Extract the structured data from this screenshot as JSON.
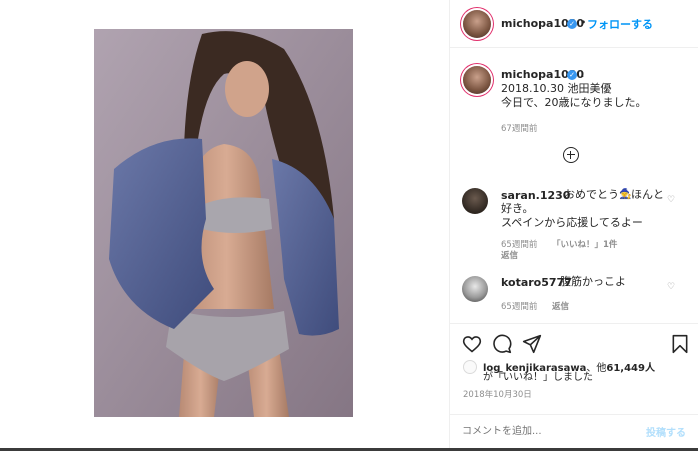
{
  "post": {
    "username": "michopa1030",
    "follow_label": "フォローする",
    "caption_dot": ".",
    "caption_line1": "2018.10.30 池田美優",
    "caption_line2": "今日で、20歳になりました。",
    "caption_age": "67週間前",
    "date": "2018年10月30日"
  },
  "comments": [
    {
      "username": "saran.1230",
      "text_line1": "おめでとう",
      "text_line1b": "ほんと",
      "text_line2": "好き。",
      "text_line3": "スペインから応援してるよー",
      "age": "65週間前",
      "likes": "「いいね！」1件",
      "reply": "返信"
    },
    {
      "username": "kotaro5777",
      "text": "腹筋かっこよ",
      "age": "65週間前",
      "reply": "返信"
    }
  ],
  "likes": {
    "user": "log_kenjikarasawa",
    "sep": "、他",
    "count": "61,449人",
    "suffix": "が「いいね！」しました"
  },
  "comment_input": {
    "placeholder": "コメントを追加...",
    "post_label": "投稿する"
  },
  "colors": {
    "accent": "#0095f6",
    "verified": "#3897f0",
    "muted": "#8e8e8e"
  }
}
